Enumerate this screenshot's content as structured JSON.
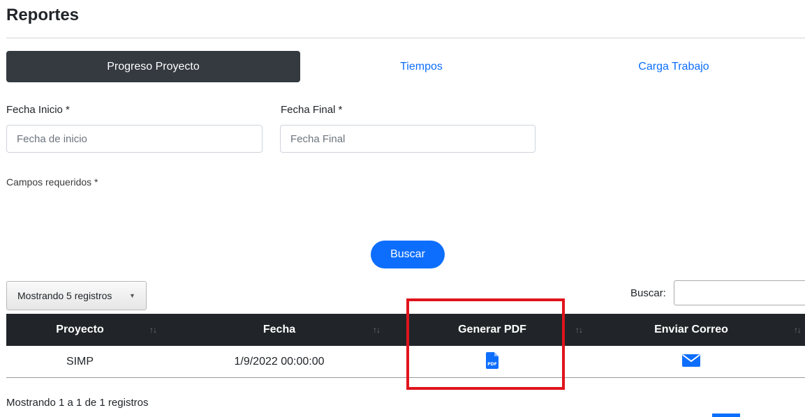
{
  "page": {
    "title": "Reportes"
  },
  "tabs": [
    {
      "label": "Progreso Proyecto",
      "active": true
    },
    {
      "label": "Tiempos",
      "active": false
    },
    {
      "label": "Carga Trabajo",
      "active": false
    }
  ],
  "form": {
    "start_label": "Fecha Inicio *",
    "start_placeholder": "Fecha de inicio",
    "end_label": "Fecha Final *",
    "end_placeholder": "Fecha Final",
    "required_note": "Campos requeridos *",
    "search_button": "Buscar"
  },
  "table_controls": {
    "length_label": "Mostrando 5 registros",
    "search_label": "Buscar:"
  },
  "table": {
    "columns": [
      "Proyecto",
      "Fecha",
      "Generar PDF",
      "Enviar Correo"
    ],
    "rows": [
      {
        "proyecto": "SIMP",
        "fecha": "1/9/2022 00:00:00",
        "pdf_icon": "pdf-file-icon",
        "mail_icon": "envelope-icon"
      }
    ],
    "info": "Mostrando 1 a 1 de 1 registros"
  },
  "colors": {
    "primary": "#0d6efd",
    "dark": "#343a40",
    "header": "#212529",
    "highlight": "#e0141c"
  }
}
